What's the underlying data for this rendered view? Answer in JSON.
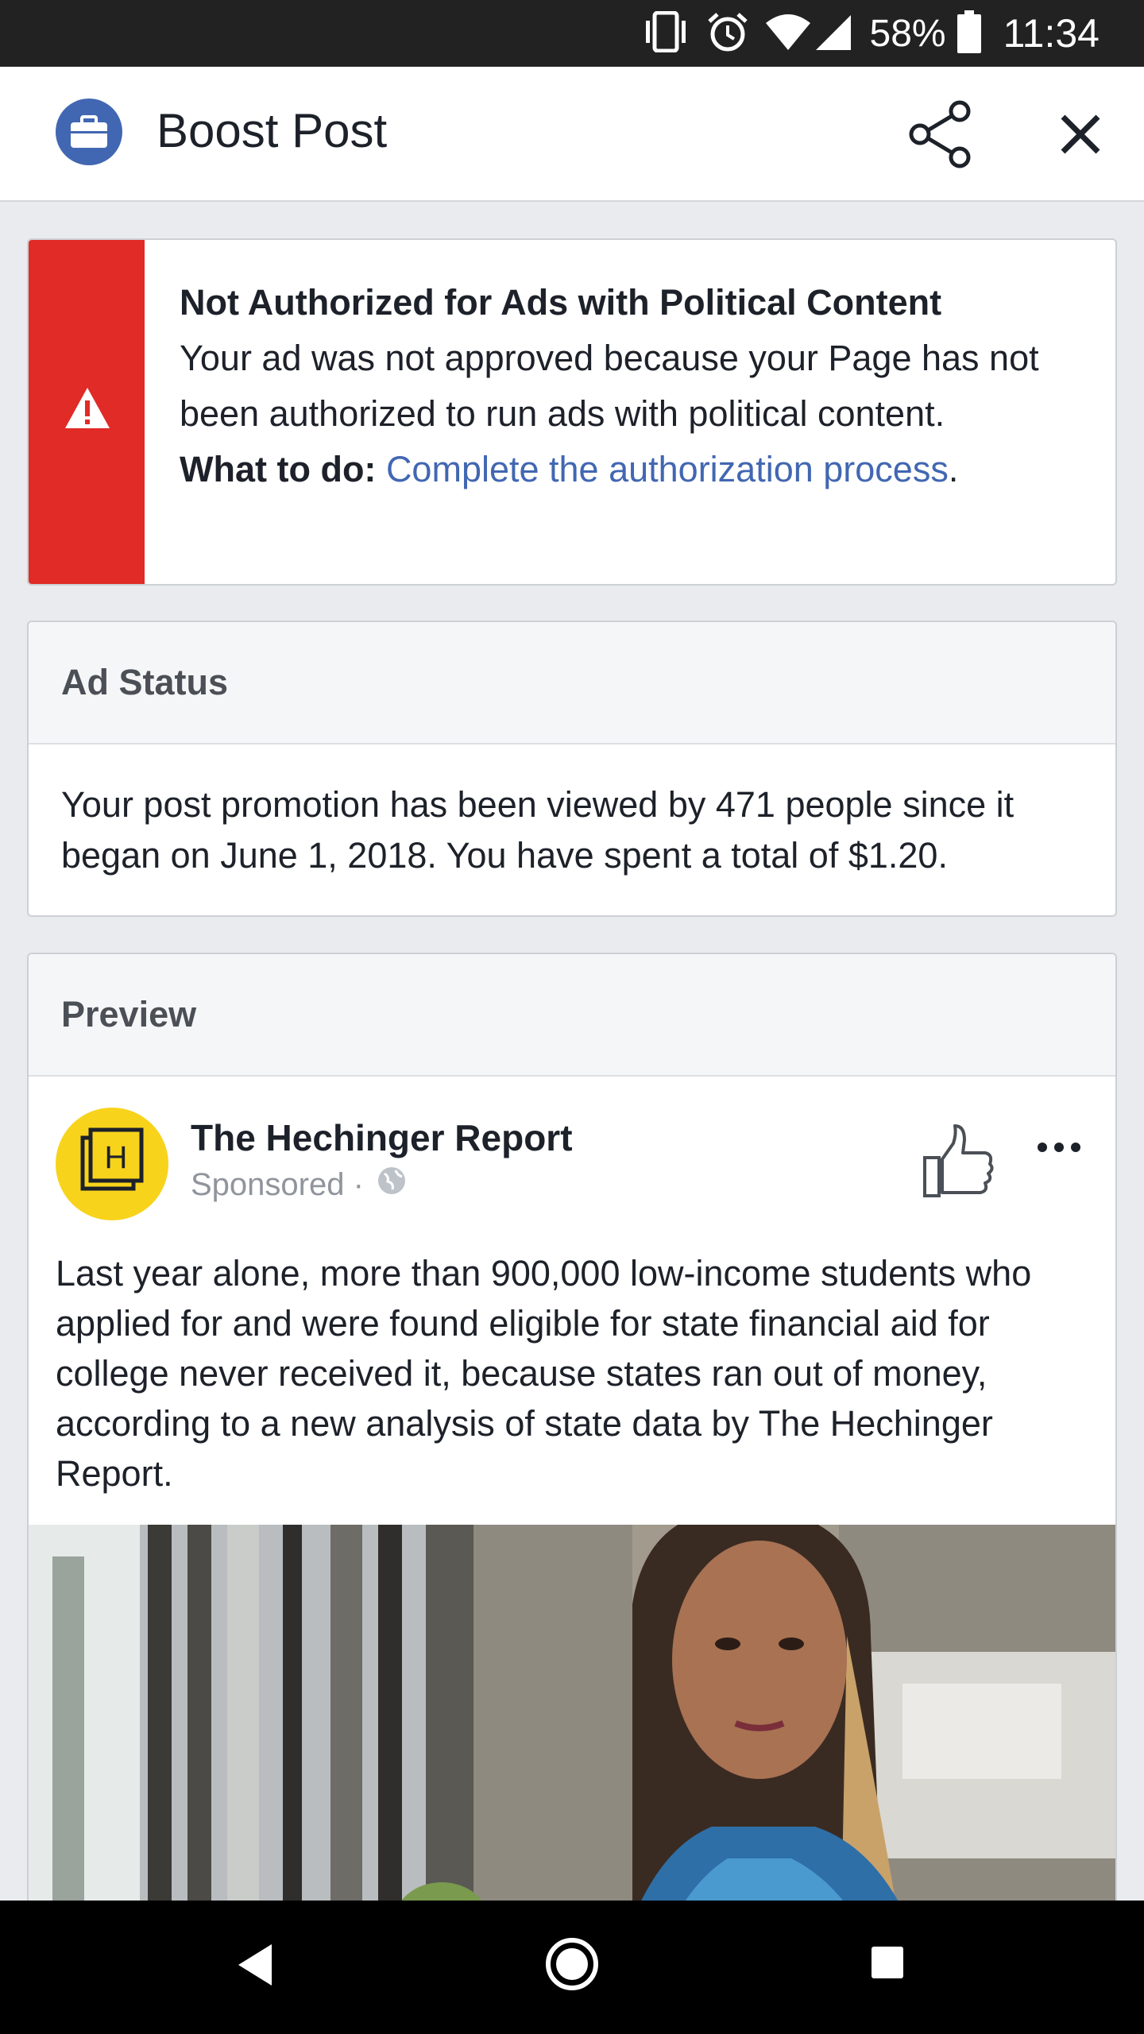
{
  "status_bar": {
    "battery_percent": "58%",
    "time": "11:34",
    "icons": [
      "vibrate-icon",
      "alarm-icon",
      "wifi-icon",
      "signal-icon",
      "battery-icon"
    ]
  },
  "app_bar": {
    "title": "Boost Post",
    "logo_icon": "briefcase-icon",
    "actions": [
      "share-icon",
      "close-icon"
    ]
  },
  "alert": {
    "title": "Not Authorized for Ads with Political Content",
    "message": "Your ad was not approved because your Page has not been authorized to run ads with political content.",
    "what_to_do_label": "What to do:",
    "link_text": "Complete the authorization process",
    "link_suffix": ".",
    "icon": "warning-icon",
    "accent_color": "#e02b27"
  },
  "ad_status": {
    "heading": "Ad Status",
    "text": "Your post promotion has been viewed by 471 people since it began on June 1, 2018. You have spent a total of $1.20."
  },
  "preview": {
    "heading": "Preview",
    "page_name": "The Hechinger Report",
    "meta": "Sponsored ·",
    "avatar_letter": "H",
    "post_text": "Last year alone, more than 900,000 low-income students who applied for and were found eligible for state financial aid for college never received it, because states ran out of money, according to a new analysis of state data by The Hechinger Report.",
    "icons": [
      "globe-icon",
      "like-icon",
      "more-icon"
    ]
  },
  "nav_bar": {
    "buttons": [
      "back-button",
      "home-button",
      "recents-button"
    ]
  },
  "colors": {
    "facebook_blue": "#4267b2",
    "alert_red": "#e02b27",
    "avatar_yellow": "#f8d31b"
  }
}
